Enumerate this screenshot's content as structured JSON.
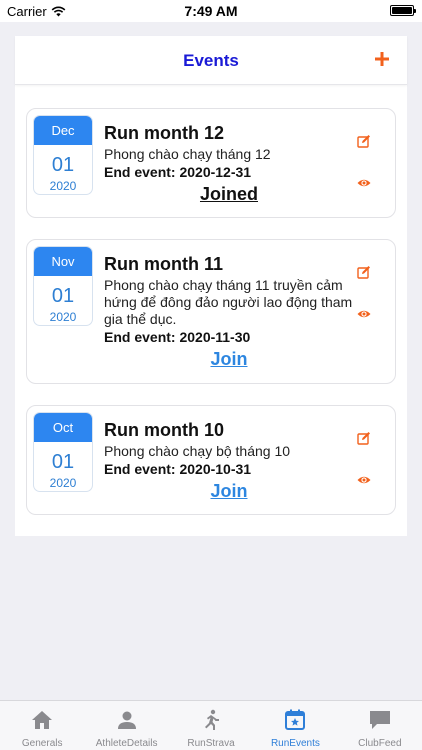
{
  "status_bar": {
    "carrier": "Carrier",
    "time": "7:49 AM"
  },
  "header": {
    "title": "Events",
    "add_icon": "plus-icon"
  },
  "events": [
    {
      "month": "Dec",
      "day": "01",
      "year": "2020",
      "title": "Run month 12",
      "description": "Phong chào chạy tháng 12",
      "end_event": "End event: 2020-12-31",
      "join_label": "Joined",
      "joined": true
    },
    {
      "month": "Nov",
      "day": "01",
      "year": "2020",
      "title": "Run month 11",
      "description": "Phong chào chạy tháng 11 truyền cảm hứng để đông đảo người lao động tham gia thể dục.",
      "end_event": "End event: 2020-11-30",
      "join_label": "Join",
      "joined": false
    },
    {
      "month": "Oct",
      "day": "01",
      "year": "2020",
      "title": "Run month 10",
      "description": "Phong chào chạy bộ  tháng 10",
      "end_event": "End event: 2020-10-31",
      "join_label": "Join",
      "joined": false
    }
  ],
  "tabs": [
    {
      "label": "Generals",
      "icon": "home-icon",
      "active": false
    },
    {
      "label": "AthleteDetails",
      "icon": "person-icon",
      "active": false
    },
    {
      "label": "RunStrava",
      "icon": "runner-icon",
      "active": false
    },
    {
      "label": "RunEvents",
      "icon": "calendar-star-icon",
      "active": true
    },
    {
      "label": "ClubFeed",
      "icon": "chat-icon",
      "active": false
    }
  ],
  "colors": {
    "accent_blue": "#2d86f0",
    "title_blue": "#1a1ad6",
    "action_orange": "#f2611c",
    "tab_active": "#2f7fd8",
    "tab_inactive": "#8a8a8e"
  }
}
